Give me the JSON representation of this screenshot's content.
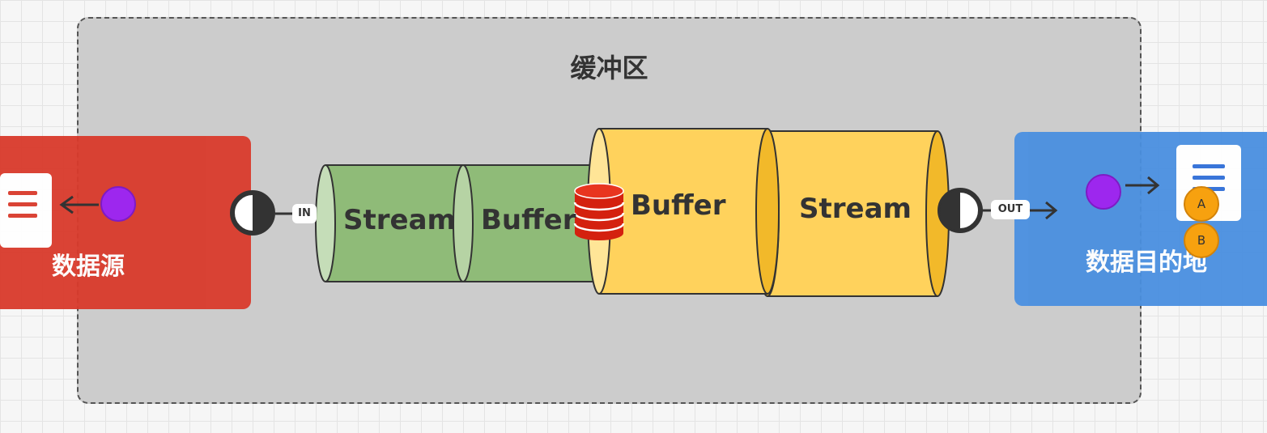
{
  "zone": {
    "title": "缓冲区"
  },
  "source": {
    "label": "数据源"
  },
  "destination": {
    "label": "数据目的地"
  },
  "connectors": {
    "in_label": "IN",
    "out_label": "OUT"
  },
  "pipeline": {
    "input_stage": {
      "stream_label": "Stream",
      "buffer_label": "Buffer"
    },
    "output_stage": {
      "buffer_label": "Buffer",
      "stream_label": "Stream"
    }
  },
  "badges": [
    "A",
    "B"
  ],
  "icons": {
    "source": "document-icon",
    "destination": "document-icon",
    "buffer": "database-icon",
    "ports": "half-circle-icon"
  },
  "colors": {
    "zone": "#cccccc",
    "source": "#d93a2b",
    "destination": "#4a8fe0",
    "input_pipe": "#8fbb78",
    "output_pipe": "#ffd25c",
    "dot": "#9b1ff0",
    "badge": "#f7a10f"
  }
}
